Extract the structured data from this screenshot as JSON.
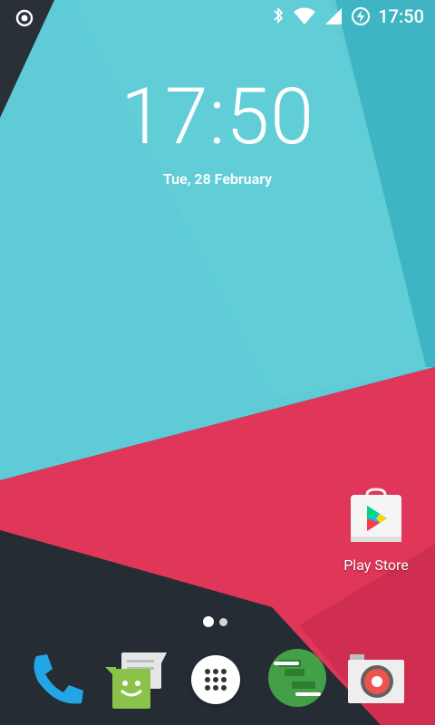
{
  "status_bar": {
    "time": "17:50",
    "left_icon": "target-icon",
    "right_icons": [
      "bluetooth-icon",
      "wifi-icon",
      "signal-icon",
      "battery-charging-icon"
    ]
  },
  "lockscreen": {
    "clock": "17:50",
    "date": "Tue, 28 February"
  },
  "desktop": {
    "icons": [
      {
        "label": "Play Store",
        "icon": "play-store-icon"
      }
    ],
    "page_indicator": {
      "pages": 2,
      "active": 1
    }
  },
  "dock": {
    "apps": [
      {
        "name": "phone",
        "icon": "phone-icon"
      },
      {
        "name": "messenger",
        "icon": "messenger-icon"
      },
      {
        "name": "all-apps",
        "icon": "all-apps-icon"
      },
      {
        "name": "hangouts",
        "icon": "hangouts-icon"
      },
      {
        "name": "camera",
        "icon": "camera-icon"
      }
    ]
  },
  "colors": {
    "teal": "#5ecbd6",
    "pink": "#e03659",
    "dark": "#1f252c"
  }
}
